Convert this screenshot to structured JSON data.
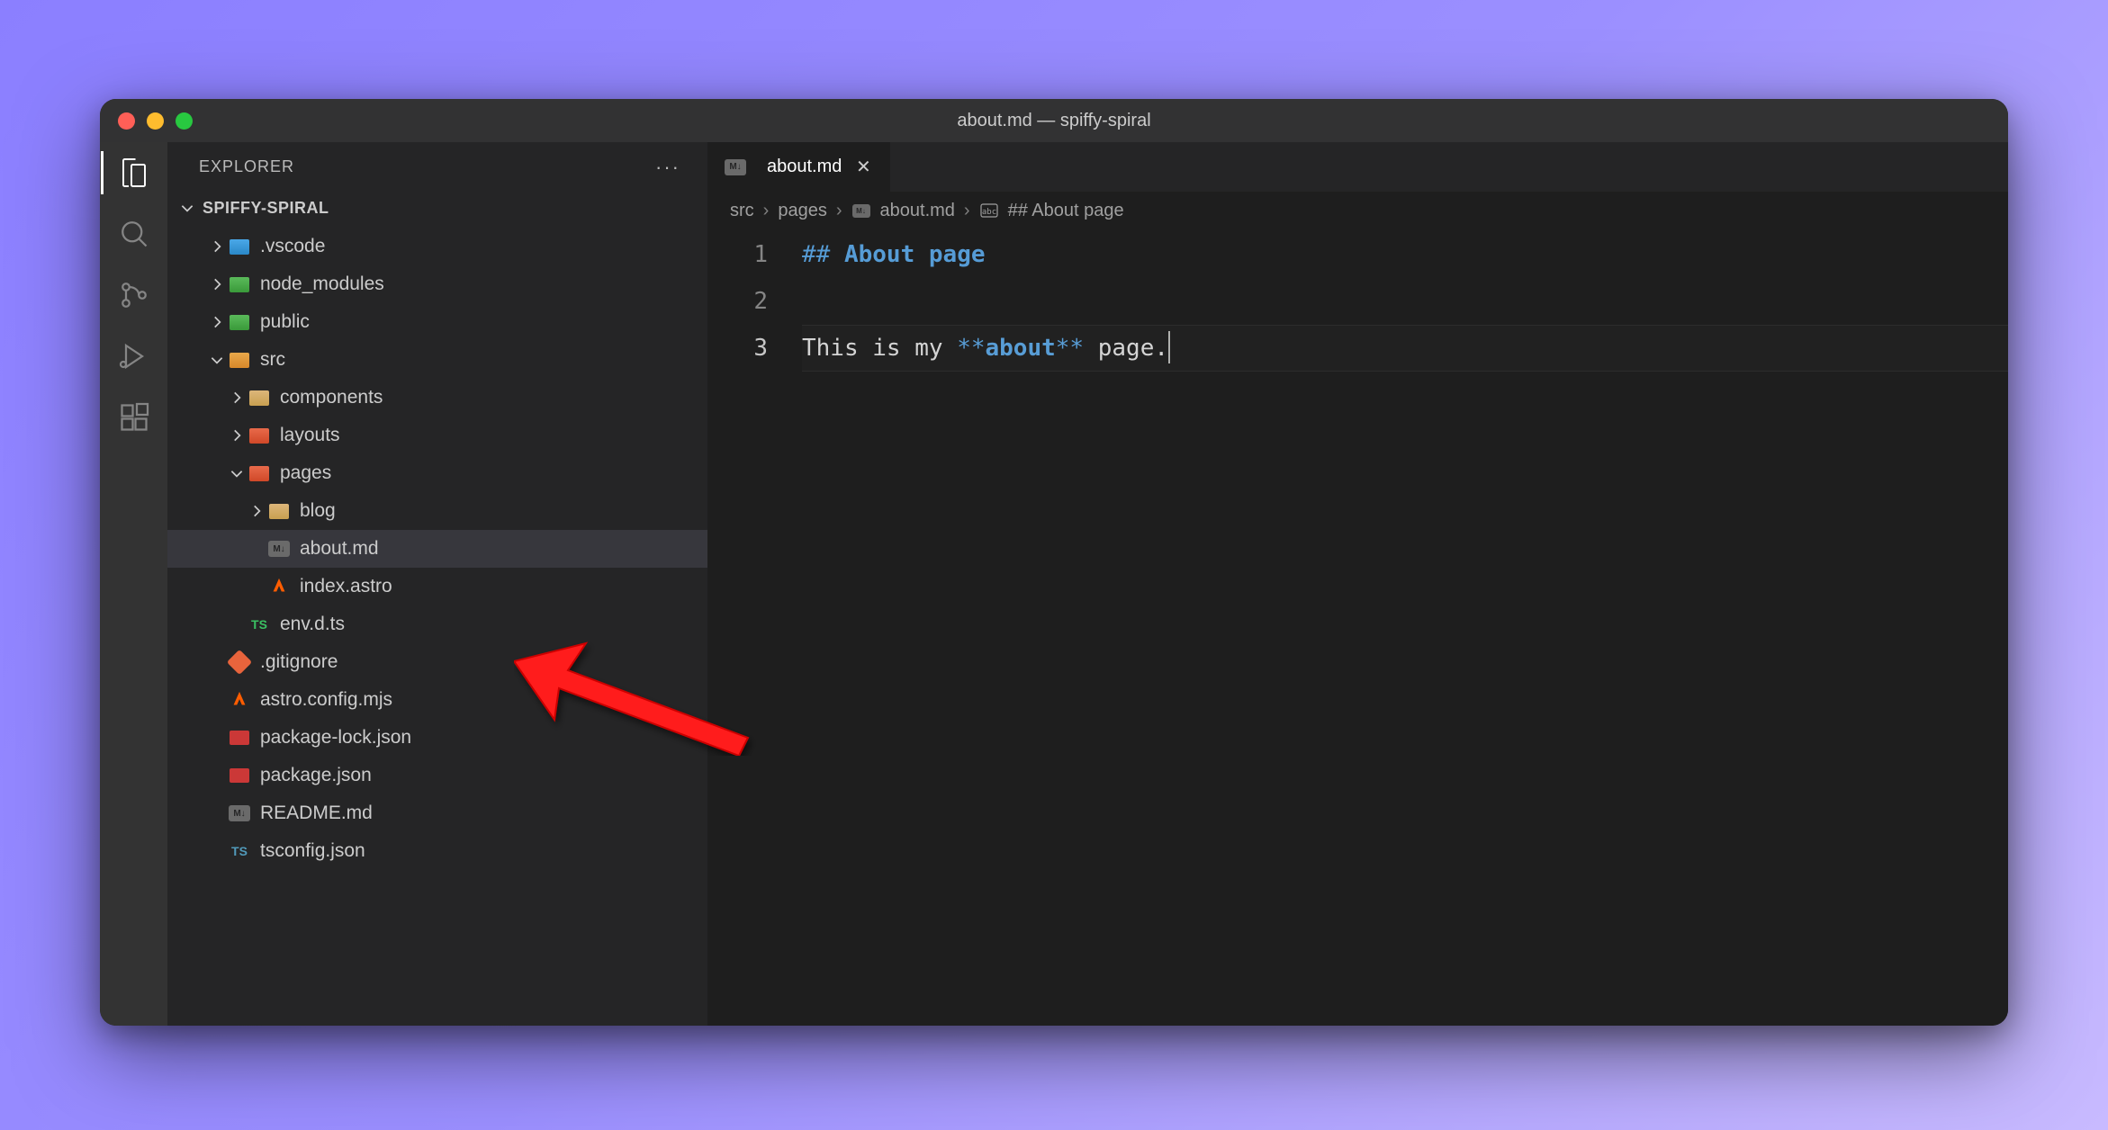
{
  "window_title": "about.md — spiffy-spiral",
  "sidebar": {
    "title": "EXPLORER",
    "project_name": "SPIFFY-SPIRAL"
  },
  "tree": {
    "vscode": ".vscode",
    "node_modules": "node_modules",
    "public": "public",
    "src": "src",
    "components": "components",
    "layouts": "layouts",
    "pages": "pages",
    "blog": "blog",
    "about_md": "about.md",
    "index_astro": "index.astro",
    "env_d_ts": "env.d.ts",
    "gitignore": ".gitignore",
    "astro_config": "astro.config.mjs",
    "package_lock": "package-lock.json",
    "package_json": "package.json",
    "readme": "README.md",
    "tsconfig": "tsconfig.json"
  },
  "tab": {
    "label": "about.md"
  },
  "breadcrumb": {
    "seg1": "src",
    "seg2": "pages",
    "seg3": "about.md",
    "seg4": "## About page"
  },
  "editor": {
    "line_numbers": {
      "l1": "1",
      "l2": "2",
      "l3": "3"
    },
    "line1": {
      "hash": "##",
      "text": " About page"
    },
    "line3": {
      "prefix": "This is my ",
      "bold_open": "**",
      "bold_text": "about",
      "bold_close": "**",
      "suffix": " page."
    }
  }
}
